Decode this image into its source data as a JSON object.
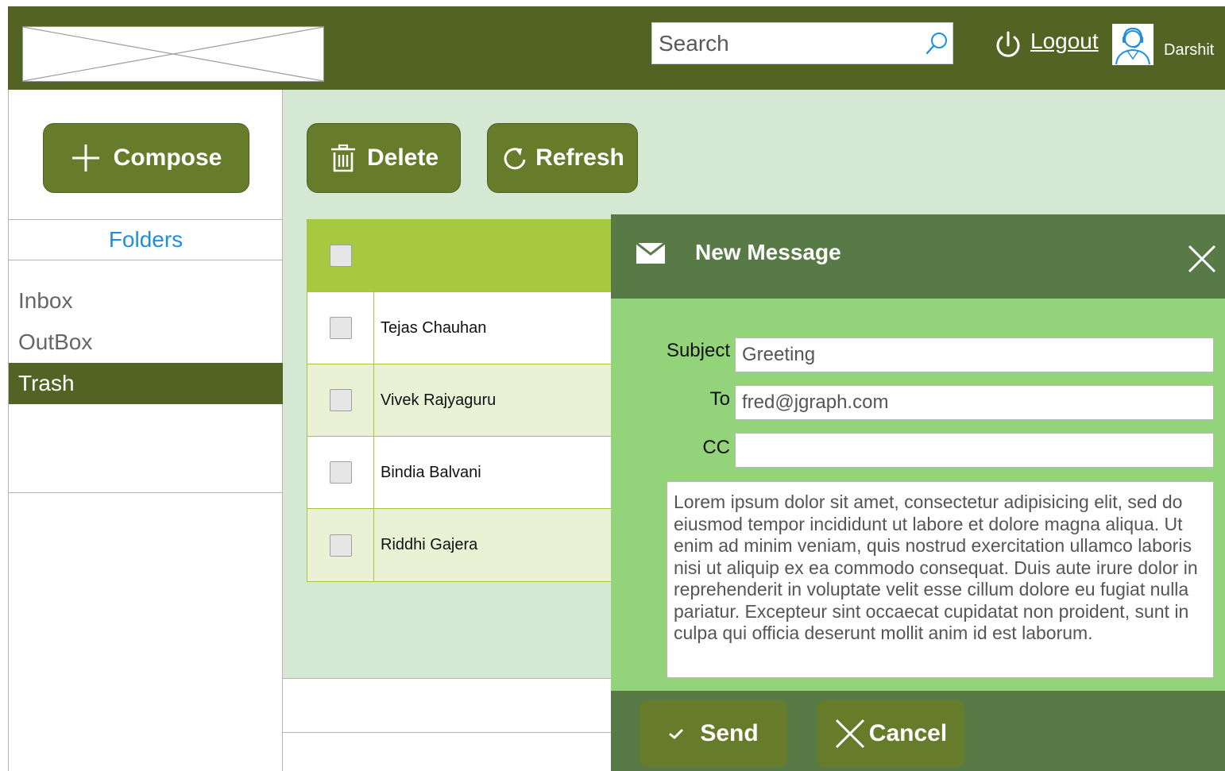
{
  "header": {
    "search_placeholder": "Search",
    "logout_label": "Logout",
    "user_name": "Darshit",
    "background_color": "#536323"
  },
  "sidebar": {
    "compose_label": "Compose",
    "folders_heading": "Folders",
    "folders": [
      {
        "label": "Inbox",
        "active": false
      },
      {
        "label": "OutBox",
        "active": false
      },
      {
        "label": "Trash",
        "active": true
      }
    ]
  },
  "toolbar": {
    "delete_label": "Delete",
    "refresh_label": "Refresh"
  },
  "mail_list": {
    "rows": [
      {
        "name": "Tejas Chauhan"
      },
      {
        "name": "Vivek Rajyaguru"
      },
      {
        "name": "Bindia Balvani"
      },
      {
        "name": "Riddhi Gajera"
      }
    ]
  },
  "compose_dialog": {
    "title": "New Message",
    "subject_label": "Subject",
    "subject_value": "Greeting",
    "to_label": "To",
    "to_value": "fred@jgraph.com",
    "cc_label": "CC",
    "cc_value": "",
    "body": "Lorem ipsum dolor sit amet, consectetur adipisicing elit, sed do eiusmod tempor incididunt ut labore et dolore magna aliqua. Ut enim ad minim veniam, quis nostrud exercitation ullamco laboris nisi ut aliquip ex ea commodo consequat. Duis aute irure dolor in reprehenderit in voluptate velit esse cillum dolore eu fugiat nulla pariatur. Excepteur sint occaecat cupidatat non proident, sunt in culpa qui officia deserunt mollit anim id est laborum.",
    "send_label": "Send",
    "cancel_label": "Cancel"
  },
  "icons": {
    "search": "search-icon",
    "power": "power-icon",
    "avatar": "user-avatar-icon",
    "compose": "plus-icon",
    "delete": "trash-icon",
    "refresh": "refresh-icon",
    "mail": "envelope-icon",
    "close": "close-icon",
    "send": "checkmark-icon",
    "cancel": "x-icon"
  },
  "colors": {
    "accent_dark": "#536323",
    "button": "#667c2b",
    "table_header": "#a6c940",
    "dialog_bg": "#93d47a",
    "dialog_bar": "#577a47",
    "folders_heading": "#1e8fe0"
  }
}
